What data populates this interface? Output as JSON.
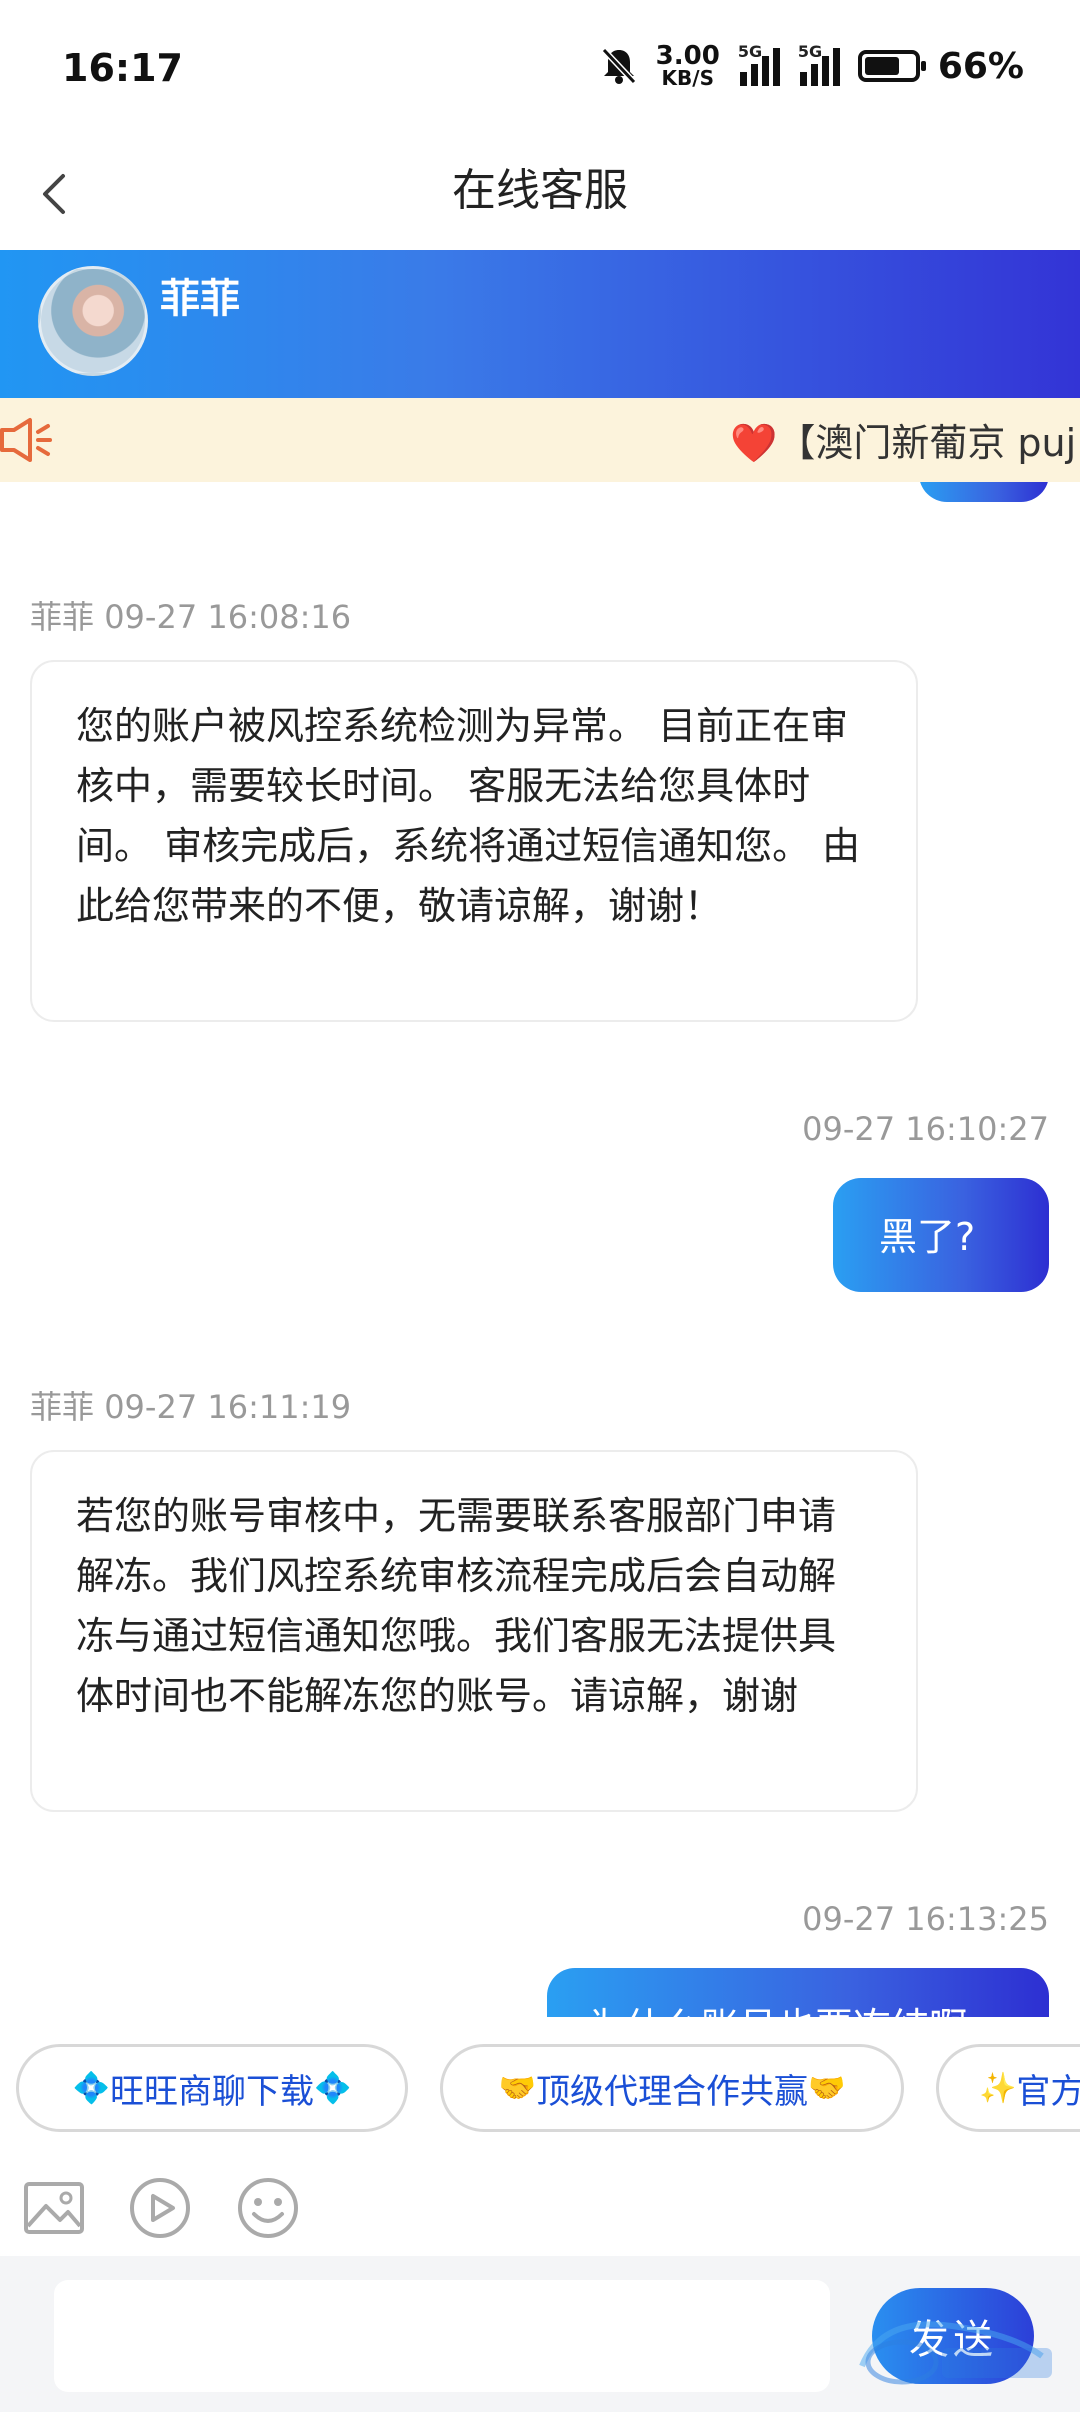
{
  "status_bar": {
    "time": "16:17",
    "speed_value": "3.00",
    "speed_unit": "KB/S",
    "signal1_tag": "5G",
    "signal2_tag": "5G",
    "battery_percent": "66%",
    "battery_level": 0.66
  },
  "nav": {
    "title": "在线客服"
  },
  "agent": {
    "name": "菲菲"
  },
  "notice": {
    "text": "❤️【澳门新葡京 puj"
  },
  "messages": [
    {
      "direction": "in",
      "sender": "菲菲",
      "time": "09-27 16:08:16",
      "text": "您的账户被风控系统检测为异常。 目前正在审核中，需要较长时间。 客服无法给您具体时间。 审核完成后，系统将通过短信通知您。 由此给您带来的不便，敬请谅解，谢谢！"
    },
    {
      "direction": "out",
      "time": "09-27 16:10:27",
      "text": "黑了?"
    },
    {
      "direction": "in",
      "sender": "菲菲",
      "time": "09-27 16:11:19",
      "text": "若您的账号审核中，无需要联系客服部门申请解冻。我们风控系统审核流程完成后会自动解冻与通过短信通知您哦。我们客服无法提供具体时间也不能解冻您的账号。请谅解，谢谢"
    },
    {
      "direction": "out",
      "time": "09-27 16:13:25",
      "text": "为什么账号也要冻结啊"
    }
  ],
  "quick_replies": [
    {
      "emoji": "💠",
      "label": "旺旺商聊下载"
    },
    {
      "emoji": "🤝",
      "label": "顶级代理合作共赢"
    },
    {
      "emoji": "✨",
      "label": "官方"
    }
  ],
  "toolbar": {
    "icons": [
      "image-icon",
      "video-icon",
      "emoji-icon"
    ]
  },
  "input": {
    "placeholder": "",
    "value": "",
    "send_label": "发送"
  },
  "colors": {
    "accent_start": "#2196f3",
    "accent_end": "#3334d6",
    "notice_bg": "#fcf3dc",
    "chip_text": "#1a4fd6"
  }
}
